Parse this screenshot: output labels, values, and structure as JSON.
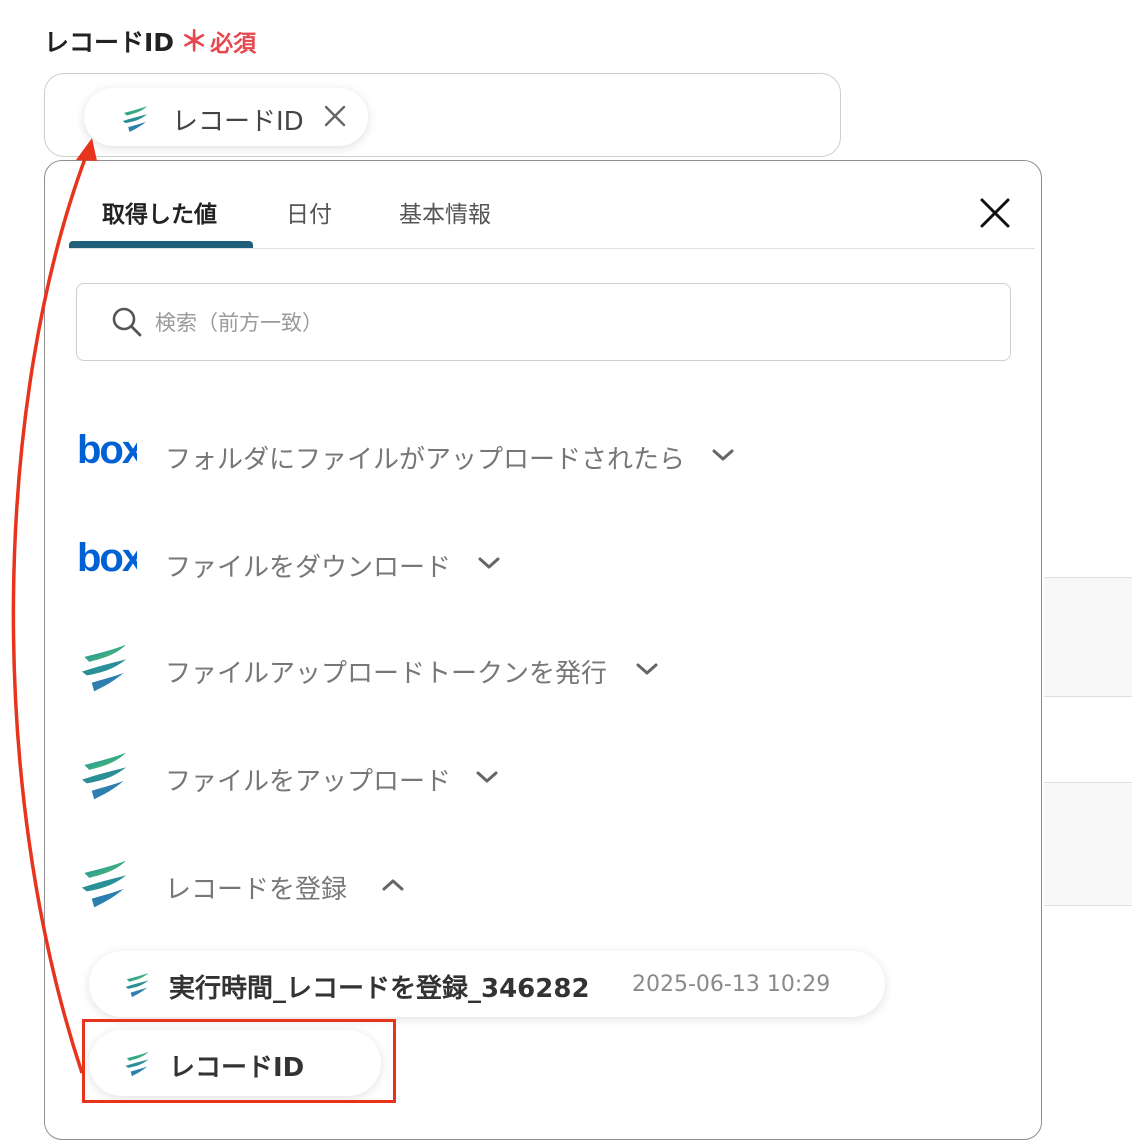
{
  "field": {
    "label": "レコードID",
    "required_mark": "＊",
    "required_text": "必須"
  },
  "selected_token": {
    "label": "レコードID",
    "icon": "yoom-logo-icon",
    "remove_icon": "close-x-icon"
  },
  "popup": {
    "tabs": [
      {
        "label": "取得した値",
        "active": true
      },
      {
        "label": "日付",
        "active": false
      },
      {
        "label": "基本情報",
        "active": false
      }
    ],
    "close_icon": "close-icon",
    "search": {
      "placeholder": "検索（前方一致）",
      "value": ""
    },
    "groups": [
      {
        "icon": "box-logo-icon",
        "label": "フォルダにファイルがアップロードされたら",
        "expanded": false
      },
      {
        "icon": "box-logo-icon",
        "label": "ファイルをダウンロード",
        "expanded": false
      },
      {
        "icon": "yoom-logo-icon",
        "label": "ファイルアップロードトークンを発行",
        "expanded": false
      },
      {
        "icon": "yoom-logo-icon",
        "label": "ファイルをアップロード",
        "expanded": false
      },
      {
        "icon": "yoom-logo-icon",
        "label": "レコードを登録",
        "expanded": true
      }
    ],
    "items": [
      {
        "icon": "yoom-logo-icon",
        "name": "実行時間_レコードを登録_346282",
        "meta": "2025-06-13 10:29"
      },
      {
        "icon": "yoom-logo-icon",
        "name": "レコードID",
        "meta": ""
      }
    ]
  },
  "colors": {
    "required": "#e5484d",
    "tab_accent": "#1f5f7a",
    "annotation": "#e8341c",
    "box_brand": "#0061d5"
  }
}
